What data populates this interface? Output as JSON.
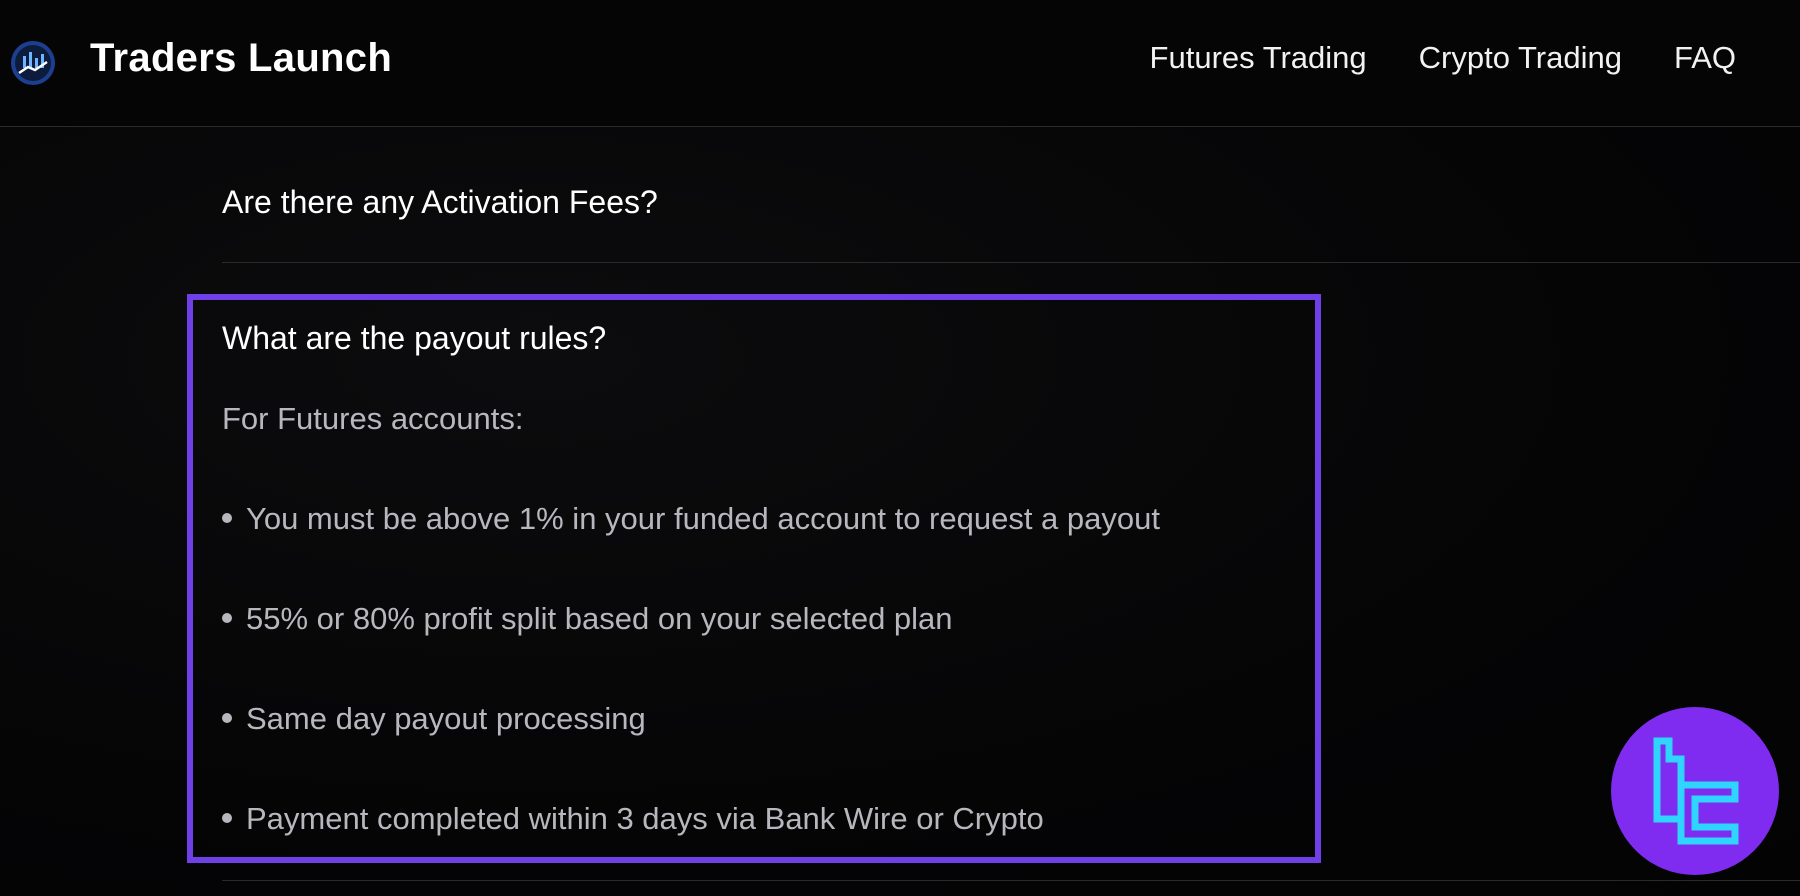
{
  "header": {
    "brand": "Traders Launch",
    "nav": [
      {
        "label": "Futures Trading"
      },
      {
        "label": "Crypto Trading"
      },
      {
        "label": "FAQ"
      }
    ],
    "logo_icon": "chart-logo-icon"
  },
  "faq": {
    "questions": [
      {
        "label": "Are there any Activation Fees?"
      },
      {
        "label": "What are the payout rules?"
      }
    ],
    "answer": {
      "intro": "For Futures accounts:",
      "bullets": [
        "You must be above 1% in your funded account to request a payout",
        "55% or 80% profit split based on your selected plan",
        "Same day payout processing",
        "Payment completed within 3 days via Bank Wire or Crypto"
      ]
    }
  },
  "colors": {
    "background": "#050506",
    "highlight_border": "#6f3fe8",
    "badge": "#7f2cf0",
    "badge_glyph": "#2fd4ff",
    "answer_text": "#b7b7bd"
  },
  "watermark": {
    "icon": "tradingfinder-logo-icon"
  }
}
